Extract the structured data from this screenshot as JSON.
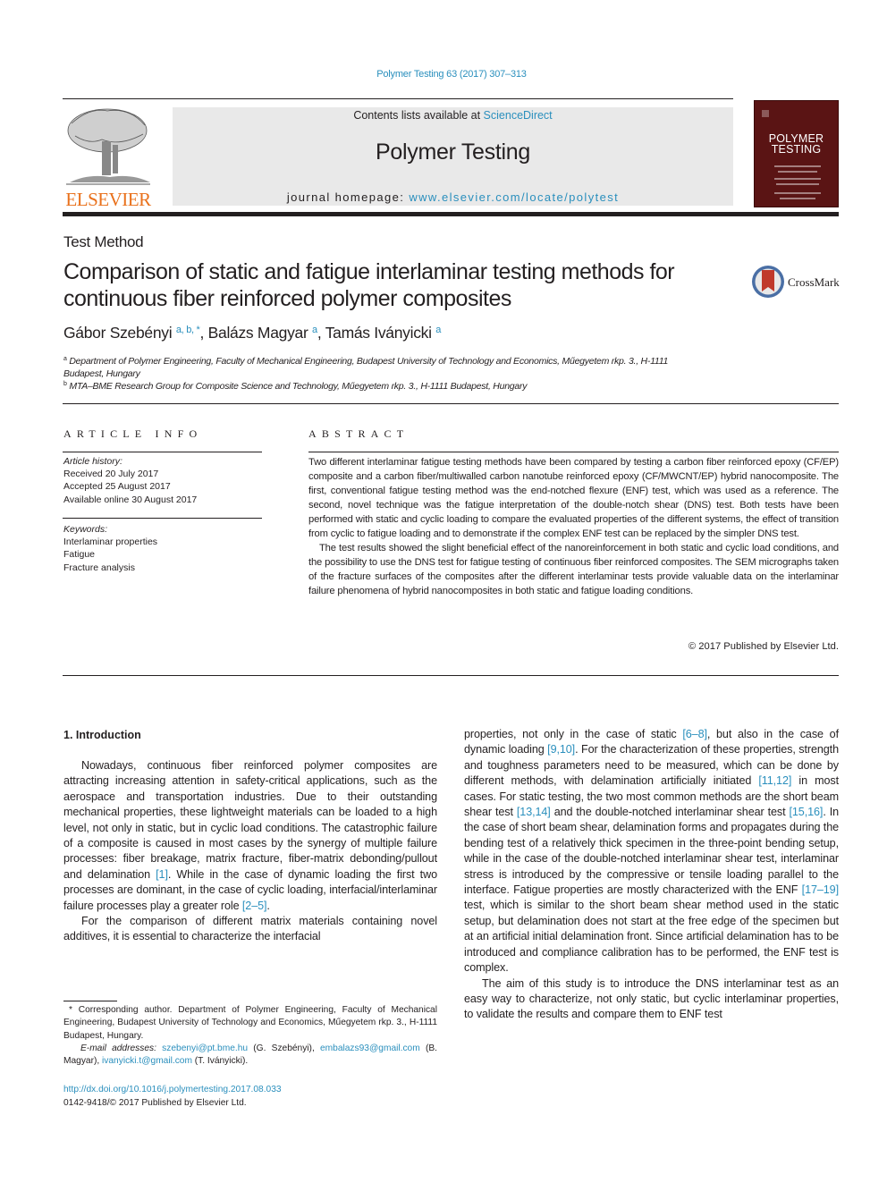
{
  "header": {
    "citation": "Polymer Testing 63 (2017) 307–313",
    "contents_prefix": "Contents lists available at ",
    "contents_link": "ScienceDirect",
    "journal_title": "Polymer Testing",
    "homepage_prefix": "journal homepage: ",
    "homepage_link": "www.elsevier.com/locate/polytest",
    "publisher_logo": "ELSEVIER",
    "cover_title_line1": "POLYMER",
    "cover_title_line2": "TESTING",
    "crossmark_label": "CrossMark"
  },
  "article": {
    "section_type": "Test Method",
    "title": "Comparison of static and fatigue interlaminar testing methods for continuous fiber reinforced polymer composites",
    "authors": [
      {
        "name": "Gábor Szebényi",
        "marks": "a, b, *"
      },
      {
        "name": "Balázs Magyar",
        "marks": "a"
      },
      {
        "name": "Tamás Iványicki",
        "marks": "a"
      }
    ],
    "affiliations": [
      {
        "mark": "a",
        "line1": "Department of Polymer Engineering, Faculty of Mechanical Engineering, Budapest University of Technology and Economics, Műegyetem rkp. 3., H-1111",
        "line2": "Budapest, Hungary"
      },
      {
        "mark": "b",
        "line1": "MTA–BME Research Group for Composite Science and Technology, Műegyetem rkp. 3., H-1111 Budapest, Hungary"
      }
    ]
  },
  "article_info": {
    "heading": "ARTICLE INFO",
    "history_label": "Article history:",
    "history": [
      "Received 20 July 2017",
      "Accepted 25 August 2017",
      "Available online 30 August 2017"
    ],
    "keywords_label": "Keywords:",
    "keywords": [
      "Interlaminar properties",
      "Fatigue",
      "Fracture analysis"
    ]
  },
  "abstract": {
    "heading": "ABSTRACT",
    "paragraphs": [
      "Two different interlaminar fatigue testing methods have been compared by testing a carbon fiber reinforced epoxy (CF/EP) composite and a carbon fiber/multiwalled carbon nanotube reinforced epoxy (CF/MWCNT/EP) hybrid nanocomposite. The first, conventional fatigue testing method was the end-notched flexure (ENF) test, which was used as a reference. The second, novel technique was the fatigue interpretation of the double-notch shear (DNS) test. Both tests have been performed with static and cyclic loading to compare the evaluated properties of the different systems, the effect of transition from cyclic to fatigue loading and to demonstrate if the complex ENF test can be replaced by the simpler DNS test.",
      "The test results showed the slight beneficial effect of the nanoreinforcement in both static and cyclic load conditions, and the possibility to use the DNS test for fatigue testing of continuous fiber reinforced composites. The SEM micrographs taken of the fracture surfaces of the composites after the different interlaminar tests provide valuable data on the interlaminar failure phenomena of hybrid nanocomposites in both static and fatigue loading conditions."
    ],
    "copyright": "© 2017 Published by Elsevier Ltd."
  },
  "introduction": {
    "heading": "1.  Introduction",
    "left": {
      "p1_a": "Nowadays, continuous fiber reinforced polymer composites are attracting increasing attention in safety-critical applications, such as the aerospace and transportation industries. Due to their outstanding mechanical properties, these lightweight materials can be loaded to a high level, not only in static, but in cyclic load conditions. The catastrophic failure of a composite is caused in most cases by the synergy of multiple failure processes: fiber breakage, matrix fracture, fiber-matrix debonding/pullout and delamination ",
      "ref1": "[1]",
      "p1_b": ". While in the case of dynamic loading the first two processes are dominant, in the case of cyclic loading, interfacial/interlaminar failure processes play a greater role ",
      "ref2": "[2–5]",
      "p1_c": ".",
      "p2": "For the comparison of different matrix materials containing novel additives, it is essential to characterize the interfacial"
    },
    "right": {
      "s1": "properties, not only in the case of static ",
      "ref1": "[6–8]",
      "s2": ", but also in the case of dynamic loading ",
      "ref2": "[9,10]",
      "s3": ". For the characterization of these properties, strength and toughness parameters need to be measured, which can be done by different methods, with delamination artificially initiated ",
      "ref3": "[11,12]",
      "s4": " in most cases. For static testing, the two most common methods are the short beam shear test ",
      "ref4": "[13,14]",
      "s5": " and the double-notched interlaminar shear test ",
      "ref5": "[15,16]",
      "s6": ". In the case of short beam shear, delamination forms and propagates during the bending test of a relatively thick specimen in the three-point bending setup, while in the case of the double-notched interlaminar shear test, interlaminar stress is introduced by the compressive or tensile loading parallel to the interface. Fatigue properties are mostly characterized with the ENF ",
      "ref6": "[17–19]",
      "s7": " test, which is similar to the short beam shear method used in the static setup, but delamination does not start at the free edge of the specimen but at an artificial initial delamination front. Since artificial delamination has to be introduced and compliance calibration has to be performed, the ENF test is complex.",
      "p2": "The aim of this study is to introduce the DNS interlaminar test as an easy way to characterize, not only static, but cyclic interlaminar properties, to validate the results and compare them to ENF test"
    }
  },
  "footnote": {
    "corresponding": "* Corresponding author. Department of Polymer Engineering, Faculty of Mechanical Engineering, Budapest University of Technology and Economics, Műegyetem rkp. 3., H-1111 Budapest, Hungary.",
    "email_label": "E-mail addresses:",
    "email1": "szebenyi@pt.bme.hu",
    "email1_name": " (G. Szebényi), ",
    "email2": "embalazs93@gmail.com",
    "email2_name": " (B. Magyar), ",
    "email3": "ivanyicki.t@gmail.com",
    "email3_name": " (T. Iványicki).",
    "doi": "http://dx.doi.org/10.1016/j.polymertesting.2017.08.033",
    "issn": "0142-9418/© 2017 Published by Elsevier Ltd."
  },
  "colors": {
    "link": "#2a8fbd",
    "elsevier_orange": "#e9711c",
    "cover": "#5a1414",
    "masthead_bg": "#e9e9e9"
  }
}
